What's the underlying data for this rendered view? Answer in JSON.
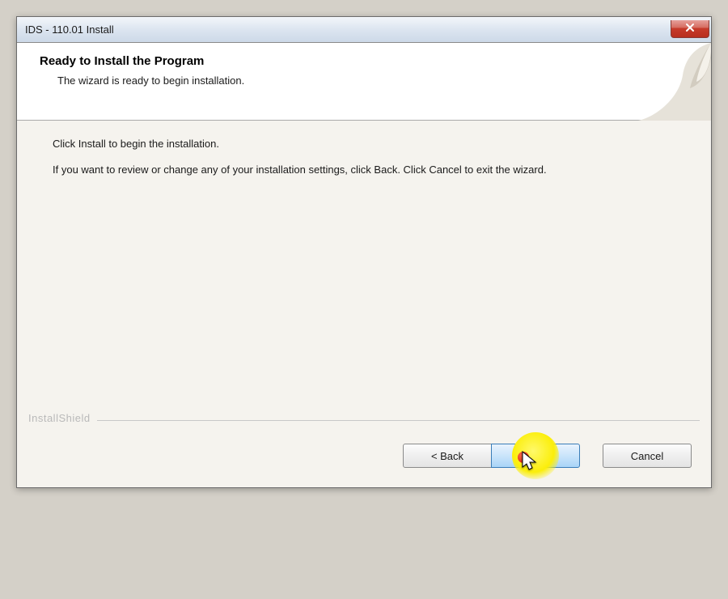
{
  "window": {
    "title": "IDS - 110.01 Install"
  },
  "header": {
    "title": "Ready to Install the Program",
    "subtitle": "The wizard is ready to begin installation."
  },
  "content": {
    "line1": "Click Install to begin the installation.",
    "line2": "If you want to review or change any of your installation settings, click Back. Click Cancel to exit the wizard."
  },
  "brand": "InstallShield",
  "buttons": {
    "back": "< Back",
    "install": "Install",
    "cancel": "Cancel"
  }
}
